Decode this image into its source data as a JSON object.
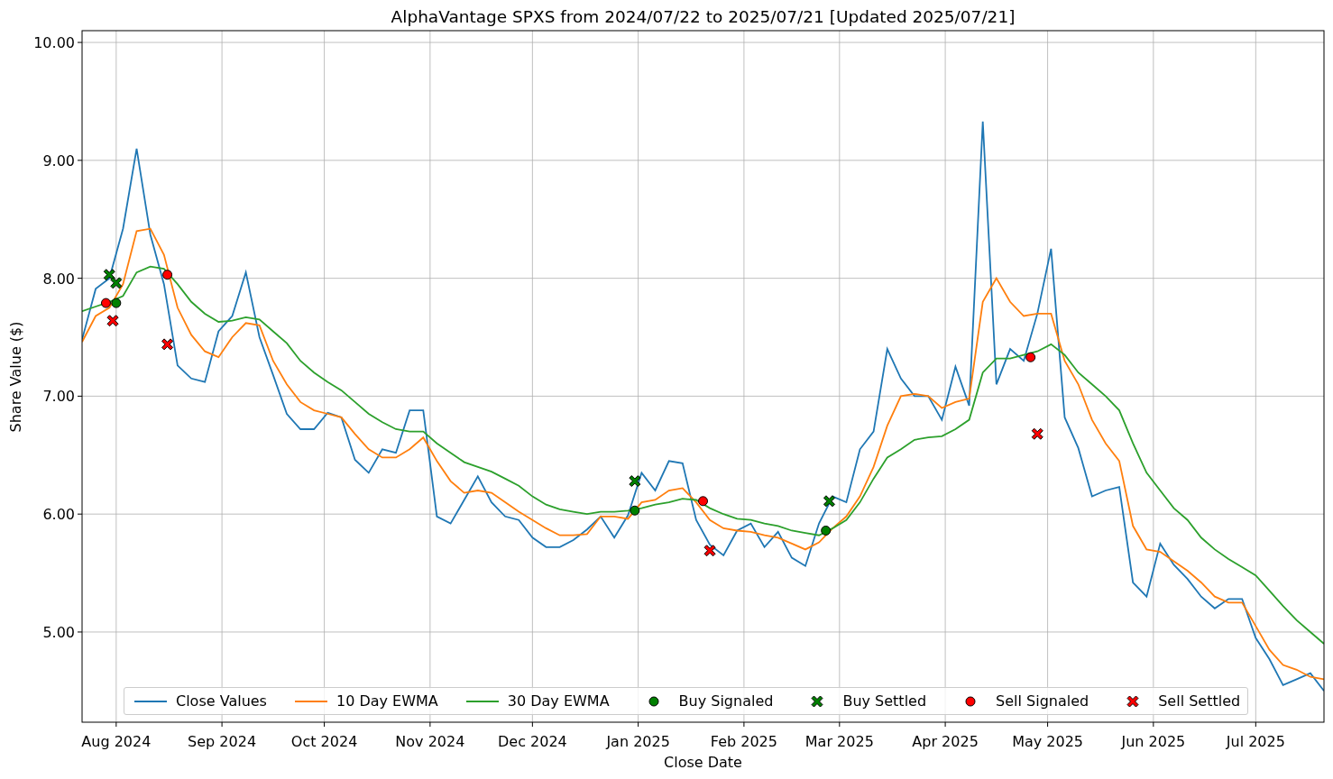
{
  "chart": {
    "chart_data": {
      "type": "line",
      "title": "AlphaVantage SPXS from 2024/07/22 to 2025/07/21 [Updated 2025/07/21]",
      "xlabel": "Close Date",
      "ylabel": "Share Value ($)",
      "x": [
        "2024-07-22",
        "2024-07-26",
        "2024-07-30",
        "2024-08-03",
        "2024-08-07",
        "2024-08-11",
        "2024-08-15",
        "2024-08-19",
        "2024-08-23",
        "2024-08-27",
        "2024-08-31",
        "2024-09-04",
        "2024-09-08",
        "2024-09-12",
        "2024-09-16",
        "2024-09-20",
        "2024-09-24",
        "2024-09-28",
        "2024-10-02",
        "2024-10-06",
        "2024-10-10",
        "2024-10-14",
        "2024-10-18",
        "2024-10-22",
        "2024-10-26",
        "2024-10-30",
        "2024-11-03",
        "2024-11-07",
        "2024-11-11",
        "2024-11-15",
        "2024-11-19",
        "2024-11-23",
        "2024-11-27",
        "2024-12-01",
        "2024-12-05",
        "2024-12-09",
        "2024-12-13",
        "2024-12-17",
        "2024-12-21",
        "2024-12-25",
        "2024-12-29",
        "2025-01-02",
        "2025-01-06",
        "2025-01-10",
        "2025-01-14",
        "2025-01-18",
        "2025-01-22",
        "2025-01-26",
        "2025-01-30",
        "2025-02-03",
        "2025-02-07",
        "2025-02-11",
        "2025-02-15",
        "2025-02-19",
        "2025-02-23",
        "2025-02-27",
        "2025-03-03",
        "2025-03-07",
        "2025-03-11",
        "2025-03-15",
        "2025-03-19",
        "2025-03-23",
        "2025-03-27",
        "2025-03-31",
        "2025-04-04",
        "2025-04-08",
        "2025-04-12",
        "2025-04-16",
        "2025-04-20",
        "2025-04-24",
        "2025-04-28",
        "2025-05-02",
        "2025-05-06",
        "2025-05-10",
        "2025-05-14",
        "2025-05-18",
        "2025-05-22",
        "2025-05-26",
        "2025-05-30",
        "2025-06-03",
        "2025-06-07",
        "2025-06-11",
        "2025-06-15",
        "2025-06-19",
        "2025-06-23",
        "2025-06-27",
        "2025-07-01",
        "2025-07-05",
        "2025-07-09",
        "2025-07-13",
        "2025-07-17",
        "2025-07-21"
      ],
      "series": [
        {
          "name": "Close Values",
          "color": "#1f77b4",
          "type": "line",
          "values": [
            7.48,
            7.91,
            8.0,
            8.42,
            9.1,
            8.37,
            7.95,
            7.26,
            7.15,
            7.12,
            7.55,
            7.68,
            8.05,
            7.5,
            7.18,
            6.85,
            6.72,
            6.72,
            6.86,
            6.82,
            6.46,
            6.35,
            6.55,
            6.52,
            6.88,
            6.88,
            5.98,
            5.92,
            6.12,
            6.32,
            6.1,
            5.98,
            5.95,
            5.8,
            5.72,
            5.72,
            5.78,
            5.87,
            5.98,
            5.8,
            5.99,
            6.35,
            6.2,
            6.45,
            6.43,
            5.95,
            5.74,
            5.65,
            5.86,
            5.92,
            5.72,
            5.85,
            5.63,
            5.56,
            5.92,
            6.15,
            6.1,
            6.55,
            6.7,
            7.4,
            7.15,
            7.0,
            7.0,
            6.8,
            7.25,
            6.92,
            9.33,
            7.1,
            7.4,
            7.3,
            7.7,
            8.25,
            6.82,
            6.56,
            6.15,
            6.2,
            6.23,
            5.42,
            5.3,
            5.75,
            5.57,
            5.45,
            5.3,
            5.2,
            5.28,
            5.28,
            4.95,
            4.77,
            4.55,
            4.6,
            4.65,
            4.5
          ]
        },
        {
          "name": "10 Day EWMA",
          "color": "#ff7f0e",
          "type": "line",
          "values": [
            7.46,
            7.68,
            7.75,
            7.95,
            8.4,
            8.42,
            8.2,
            7.75,
            7.52,
            7.38,
            7.33,
            7.5,
            7.62,
            7.6,
            7.3,
            7.1,
            6.95,
            6.88,
            6.85,
            6.82,
            6.68,
            6.55,
            6.48,
            6.48,
            6.55,
            6.65,
            6.45,
            6.28,
            6.18,
            6.2,
            6.18,
            6.1,
            6.02,
            5.95,
            5.88,
            5.82,
            5.82,
            5.83,
            5.98,
            5.98,
            5.96,
            6.1,
            6.12,
            6.2,
            6.22,
            6.1,
            5.95,
            5.88,
            5.86,
            5.85,
            5.82,
            5.8,
            5.75,
            5.7,
            5.76,
            5.88,
            5.98,
            6.15,
            6.4,
            6.75,
            7.0,
            7.02,
            7.0,
            6.9,
            6.95,
            6.98,
            7.8,
            8.0,
            7.8,
            7.68,
            7.7,
            7.7,
            7.3,
            7.1,
            6.8,
            6.6,
            6.45,
            5.9,
            5.7,
            5.68,
            5.6,
            5.52,
            5.42,
            5.3,
            5.25,
            5.25,
            5.05,
            4.85,
            4.72,
            4.68,
            4.62,
            4.6
          ]
        },
        {
          "name": "30 Day EWMA",
          "color": "#2ca02c",
          "type": "line",
          "values": [
            7.72,
            7.76,
            7.8,
            7.85,
            8.05,
            8.1,
            8.08,
            7.95,
            7.8,
            7.7,
            7.63,
            7.64,
            7.67,
            7.65,
            7.55,
            7.45,
            7.3,
            7.2,
            7.12,
            7.05,
            6.95,
            6.85,
            6.78,
            6.72,
            6.7,
            6.7,
            6.6,
            6.52,
            6.44,
            6.4,
            6.36,
            6.3,
            6.24,
            6.15,
            6.08,
            6.04,
            6.02,
            6.0,
            6.02,
            6.02,
            6.03,
            6.05,
            6.08,
            6.1,
            6.13,
            6.12,
            6.05,
            6.0,
            5.96,
            5.95,
            5.92,
            5.9,
            5.86,
            5.84,
            5.82,
            5.88,
            5.95,
            6.1,
            6.3,
            6.48,
            6.55,
            6.63,
            6.65,
            6.66,
            6.72,
            6.8,
            7.2,
            7.32,
            7.32,
            7.35,
            7.38,
            7.44,
            7.35,
            7.2,
            7.1,
            7.0,
            6.88,
            6.6,
            6.35,
            6.2,
            6.05,
            5.95,
            5.8,
            5.7,
            5.62,
            5.55,
            5.48,
            5.35,
            5.22,
            5.1,
            5.0,
            4.9
          ]
        },
        {
          "name": "Buy Signaled",
          "color": "#008000",
          "type": "scatter",
          "marker": "circle",
          "x": [
            "2024-08-01",
            "2024-12-31",
            "2025-02-25"
          ],
          "values": [
            7.79,
            6.03,
            5.86
          ]
        },
        {
          "name": "Buy Settled",
          "color": "#008000",
          "type": "scatter",
          "marker": "cross",
          "x": [
            "2024-07-30",
            "2024-08-01",
            "2024-12-31",
            "2025-02-26"
          ],
          "values": [
            8.03,
            7.96,
            6.28,
            6.11
          ]
        },
        {
          "name": "Sell Signaled",
          "color": "#ff0000",
          "type": "scatter",
          "marker": "circle",
          "x": [
            "2024-07-29",
            "2024-08-16",
            "2025-01-20",
            "2025-04-26"
          ],
          "values": [
            7.79,
            8.03,
            6.11,
            7.33
          ]
        },
        {
          "name": "Sell Settled",
          "color": "#ff0000",
          "type": "scatter",
          "marker": "cross",
          "x": [
            "2024-07-31",
            "2024-08-16",
            "2025-01-22",
            "2025-04-28"
          ],
          "values": [
            7.64,
            7.44,
            5.69,
            6.68
          ]
        }
      ],
      "grid": true,
      "xlim": [
        "2024-07-22",
        "2025-07-21"
      ],
      "ylim": [
        4.235,
        10.1
      ],
      "xticks": [
        {
          "value": "2024-08-01",
          "label": "Aug 2024"
        },
        {
          "value": "2024-09-01",
          "label": "Sep 2024"
        },
        {
          "value": "2024-10-01",
          "label": "Oct 2024"
        },
        {
          "value": "2024-11-01",
          "label": "Nov 2024"
        },
        {
          "value": "2024-12-01",
          "label": "Dec 2024"
        },
        {
          "value": "2025-01-01",
          "label": "Jan 2025"
        },
        {
          "value": "2025-02-01",
          "label": "Feb 2025"
        },
        {
          "value": "2025-03-01",
          "label": "Mar 2025"
        },
        {
          "value": "2025-04-01",
          "label": "Apr 2025"
        },
        {
          "value": "2025-05-01",
          "label": "May 2025"
        },
        {
          "value": "2025-06-01",
          "label": "Jun 2025"
        },
        {
          "value": "2025-07-01",
          "label": "Jul 2025"
        }
      ],
      "yticks": [
        {
          "value": 5,
          "label": "5.00"
        },
        {
          "value": 6,
          "label": "6.00"
        },
        {
          "value": 7,
          "label": "7.00"
        },
        {
          "value": 8,
          "label": "8.00"
        },
        {
          "value": 9,
          "label": "9.00"
        },
        {
          "value": 10,
          "label": "10.00"
        }
      ]
    }
  }
}
